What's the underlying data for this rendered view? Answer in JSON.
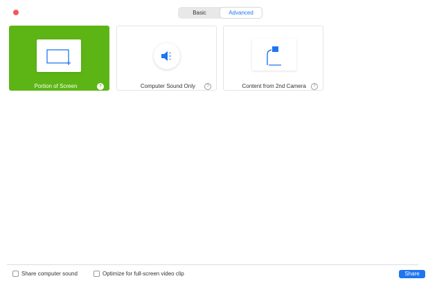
{
  "tabs": {
    "basic": "Basic",
    "advanced": "Advanced",
    "active": "Advanced"
  },
  "options": [
    {
      "label": "Portion of Screen",
      "icon": "screen-portion-icon",
      "selected": true
    },
    {
      "label": "Computer Sound Only",
      "icon": "speaker-icon",
      "selected": false
    },
    {
      "label": "Content from 2nd Camera",
      "icon": "document-camera-icon",
      "selected": false
    }
  ],
  "help_glyph": "?",
  "footer": {
    "share_sound_label": "Share computer sound",
    "optimize_label": "Optimize for full-screen video clip",
    "share_button_label": "Share"
  },
  "colors": {
    "accent_blue": "#1f75f0",
    "selected_green": "#5db515",
    "close_red": "#ee5b55"
  }
}
